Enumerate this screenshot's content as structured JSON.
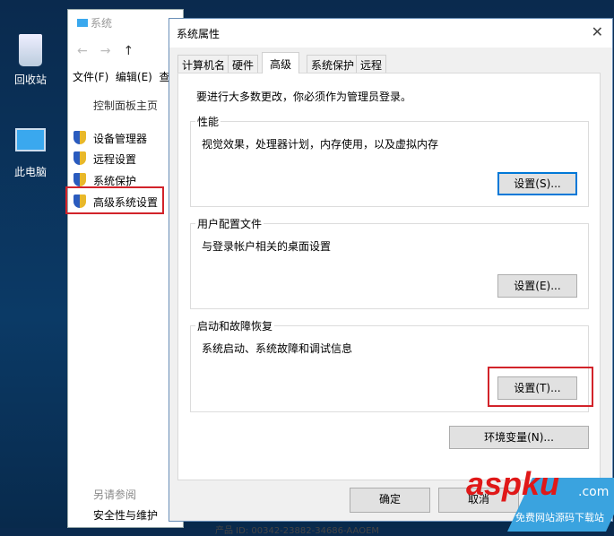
{
  "desktop": {
    "icons": [
      {
        "label": "回收站"
      },
      {
        "label": "此电脑"
      }
    ]
  },
  "system_window": {
    "title": "系统",
    "menu": [
      "文件(F)",
      "编辑(E)",
      "查"
    ],
    "home_link": "控制面板主页",
    "links": [
      "设备管理器",
      "远程设置",
      "系统保护",
      "高级系统设置"
    ],
    "see_also": "另请参阅",
    "see_also_links": [
      "安全性与维护"
    ],
    "status": "产品 ID: 00342-23882-34686-AAOEM"
  },
  "dialog": {
    "title": "系统属性",
    "tabs": [
      "计算机名",
      "硬件",
      "高级",
      "系统保护",
      "远程"
    ],
    "active_tab": "高级",
    "admin_note": "要进行大多数更改，你必须作为管理员登录。",
    "groups": [
      {
        "title": "性能",
        "desc": "视觉效果，处理器计划，内存使用，以及虚拟内存",
        "button": "设置(S)..."
      },
      {
        "title": "用户配置文件",
        "desc": "与登录帐户相关的桌面设置",
        "button": "设置(E)..."
      },
      {
        "title": "启动和故障恢复",
        "desc": "系统启动、系统故障和调试信息",
        "button": "设置(T)..."
      }
    ],
    "env_button": "环境变量(N)...",
    "ok": "确定",
    "cancel": "取消"
  },
  "watermark": {
    "brand": "aspku",
    "suffix": ".com",
    "tagline": "免费网站源码下载站"
  },
  "colors": {
    "highlight": "#d2232a",
    "link": "#1a3f8a",
    "focus": "#0078d7"
  }
}
